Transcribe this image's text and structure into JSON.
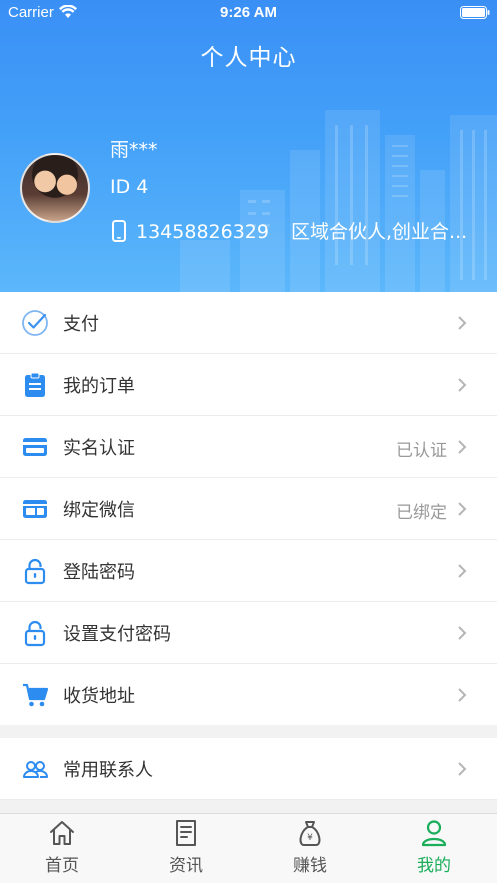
{
  "status": {
    "carrier": "Carrier",
    "time": "9:26 AM"
  },
  "nav": {
    "title": "个人中心"
  },
  "profile": {
    "name": "雨***",
    "id": "ID 4",
    "phone": "13458826329",
    "role": "区域合伙人,创业合..."
  },
  "menu": [
    {
      "label": "支付",
      "value": "",
      "icon": "check-circle-icon"
    },
    {
      "label": "我的订单",
      "value": "",
      "icon": "clipboard-icon"
    },
    {
      "label": "实名认证",
      "value": "已认证",
      "icon": "card-icon"
    },
    {
      "label": "绑定微信",
      "value": "已绑定",
      "icon": "window-card-icon"
    },
    {
      "label": "登陆密码",
      "value": "",
      "icon": "lock-icon"
    },
    {
      "label": "设置支付密码",
      "value": "",
      "icon": "lock-icon"
    },
    {
      "label": "收货地址",
      "value": "",
      "icon": "cart-icon"
    }
  ],
  "menu2": [
    {
      "label": "常用联系人",
      "value": "",
      "icon": "contacts-icon"
    }
  ],
  "tabs": [
    {
      "label": "首页",
      "icon": "home-icon",
      "active": false
    },
    {
      "label": "资讯",
      "icon": "news-icon",
      "active": false
    },
    {
      "label": "赚钱",
      "icon": "money-bag-icon",
      "active": false
    },
    {
      "label": "我的",
      "icon": "person-icon",
      "active": true
    }
  ],
  "colors": {
    "accent": "#2d8cf0",
    "active_tab": "#1aad5a",
    "header_top": "#3a8ff5",
    "header_bottom": "#5cb7fb"
  }
}
